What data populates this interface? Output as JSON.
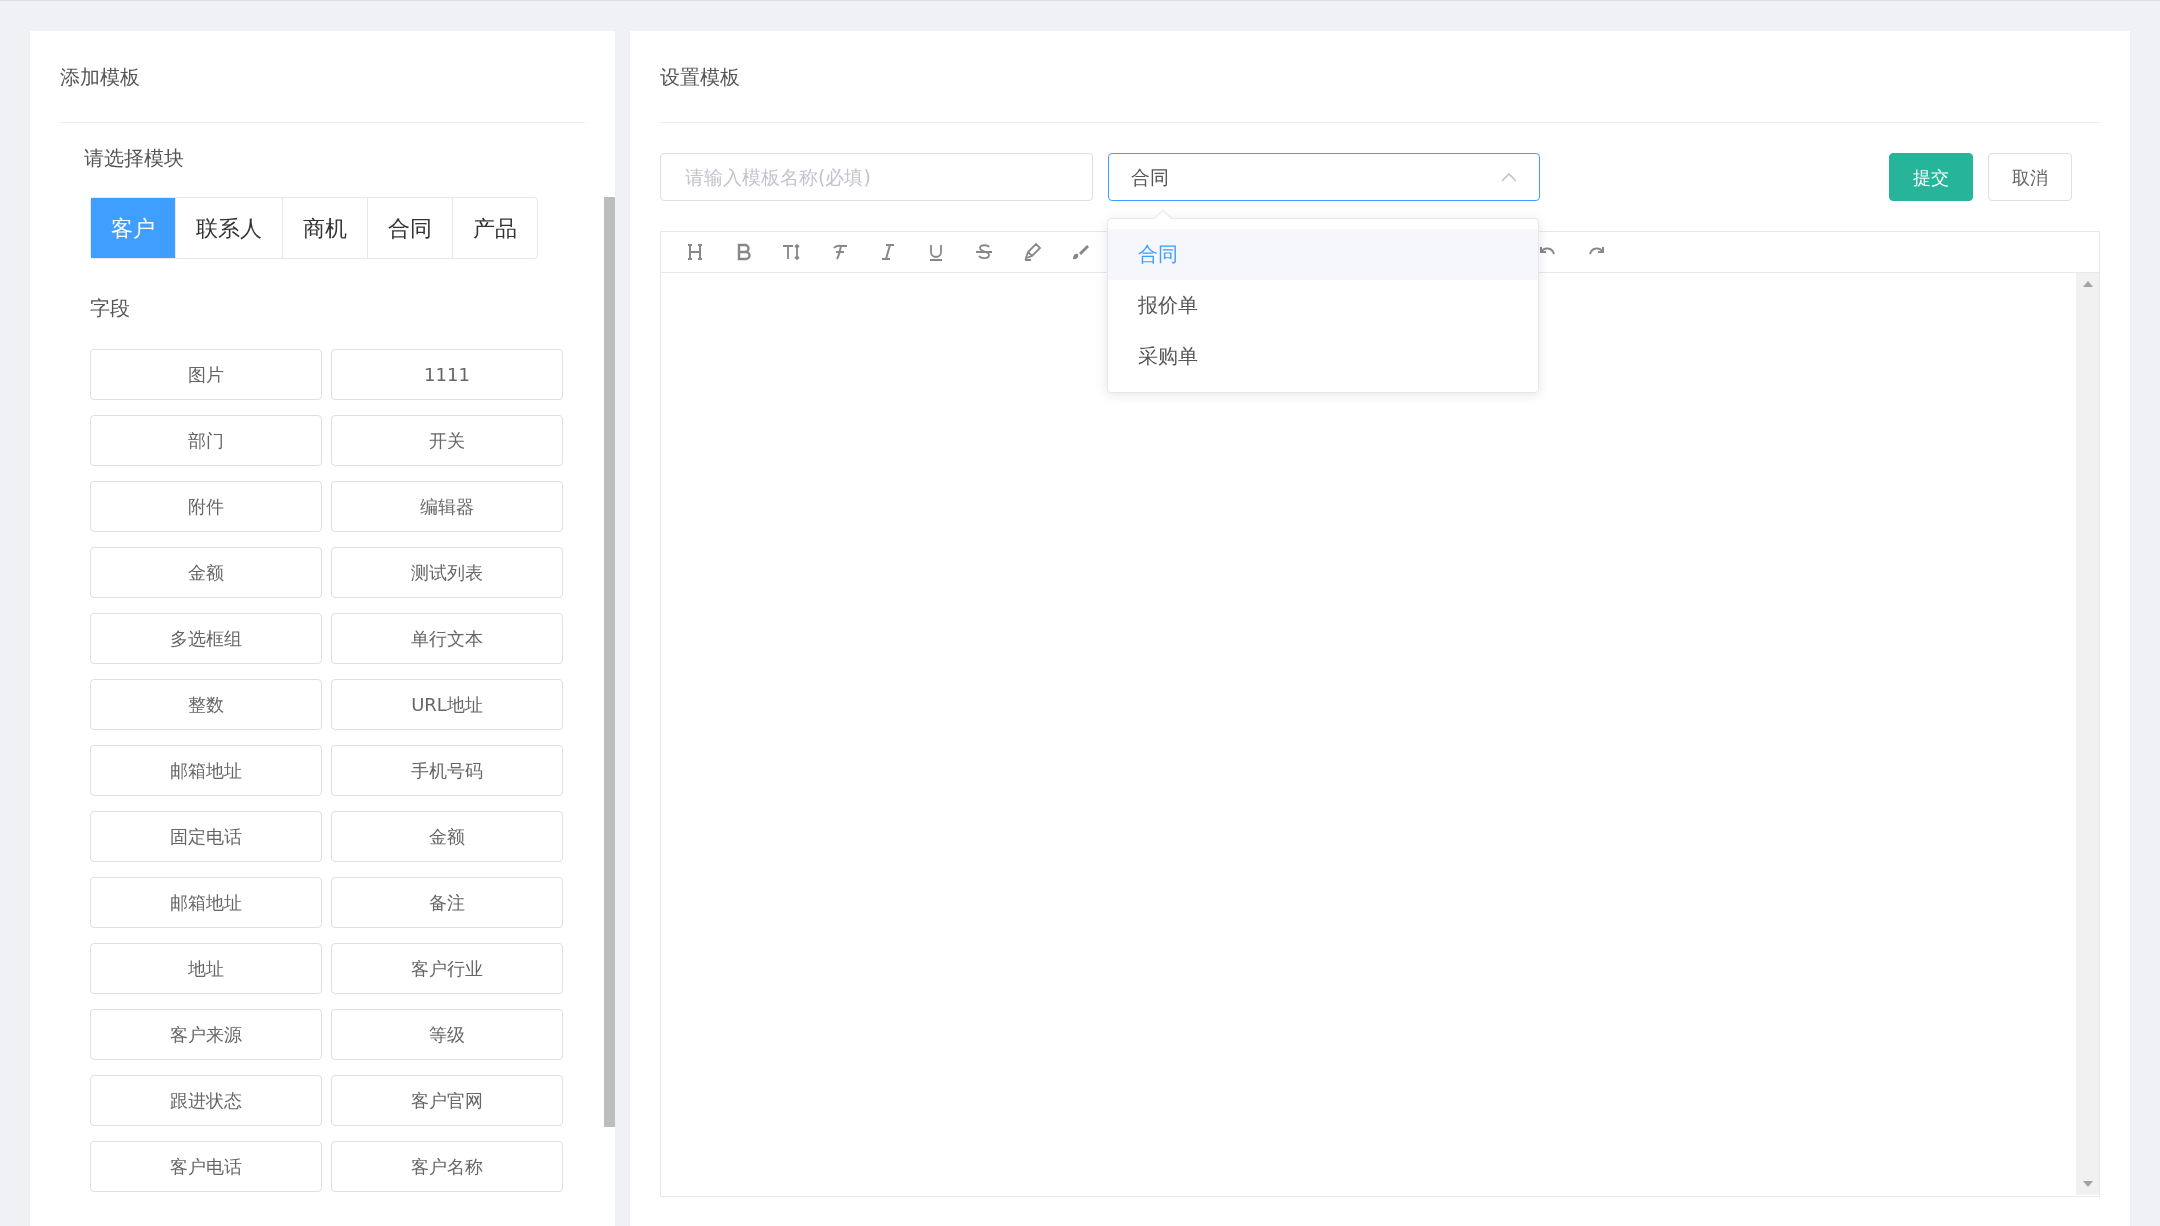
{
  "left_panel": {
    "title": "添加模板",
    "section_label": "请选择模块",
    "tabs": [
      {
        "label": "客户",
        "selected": true
      },
      {
        "label": "联系人",
        "selected": false
      },
      {
        "label": "商机",
        "selected": false
      },
      {
        "label": "合同",
        "selected": false
      },
      {
        "label": "产品",
        "selected": false
      }
    ],
    "fields_label": "字段",
    "fields": [
      "图片",
      "1111",
      "部门",
      "开关",
      "附件",
      "编辑器",
      "金额",
      "测试列表",
      "多选框组",
      "单行文本",
      "整数",
      "URL地址",
      "邮箱地址",
      "手机号码",
      "固定电话",
      "金额",
      "邮箱地址",
      "备注",
      "地址",
      "客户行业",
      "客户来源",
      "等级",
      "跟进状态",
      "客户官网",
      "客户电话",
      "客户名称"
    ]
  },
  "right_panel": {
    "title": "设置模板",
    "name_input": {
      "placeholder": "请输入模板名称(必填)"
    },
    "type_select": {
      "value": "合同",
      "expanded": true,
      "options": [
        {
          "label": "合同",
          "selected": true
        },
        {
          "label": "报价单",
          "selected": false
        },
        {
          "label": "采购单",
          "selected": false
        }
      ]
    },
    "buttons": [
      {
        "label": "提交",
        "kind": "primary"
      },
      {
        "label": "取消",
        "kind": "default"
      }
    ]
  }
}
